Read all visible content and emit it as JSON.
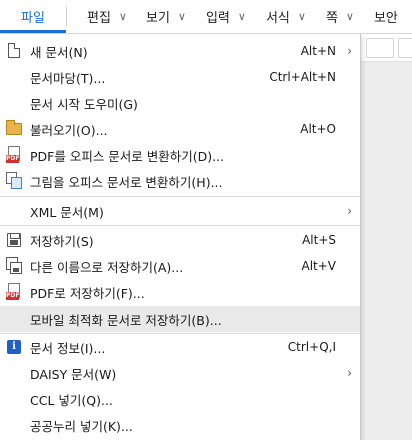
{
  "menubar": {
    "file": "파일",
    "items": [
      {
        "label": "편집"
      },
      {
        "label": "보기"
      },
      {
        "label": "입력"
      },
      {
        "label": "서식"
      },
      {
        "label": "쪽"
      },
      {
        "label": "보안"
      }
    ]
  },
  "menu": {
    "items": [
      {
        "label": "새 문서(N)",
        "shortcut": "Alt+N",
        "icon": "new-document-icon"
      },
      {
        "label": "문서마당(T)...",
        "shortcut": "Ctrl+Alt+N"
      },
      {
        "label": "문서 시작 도우미(G)"
      },
      {
        "label": "불러오기(O)...",
        "shortcut": "Alt+O",
        "icon": "open-folder-icon"
      },
      {
        "label": "PDF를 오피스 문서로 변환하기(D)...",
        "icon": "pdf-icon"
      },
      {
        "label": "그림을 오피스 문서로 변환하기(H)...",
        "icon": "image-convert-icon"
      },
      {
        "label": "XML 문서(M)",
        "submenu": true
      },
      {
        "label": "저장하기(S)",
        "shortcut": "Alt+S",
        "icon": "save-icon"
      },
      {
        "label": "다른 이름으로 저장하기(A)...",
        "shortcut": "Alt+V",
        "icon": "save-as-icon"
      },
      {
        "label": "PDF로 저장하기(F)...",
        "icon": "pdf-icon"
      },
      {
        "label": "모바일 최적화 문서로 저장하기(B)...",
        "highlighted": true
      },
      {
        "label": "문서 정보(I)...",
        "shortcut": "Ctrl+Q,I",
        "icon": "info-icon"
      },
      {
        "label": "DAISY 문서(W)",
        "submenu": true
      },
      {
        "label": "CCL 넣기(Q)..."
      },
      {
        "label": "공공누리 넣기(K)..."
      }
    ]
  },
  "glyphs": {
    "chevron_down": "∨",
    "chevron_right": "›",
    "info": "i",
    "pdf_tag": "PDF"
  }
}
